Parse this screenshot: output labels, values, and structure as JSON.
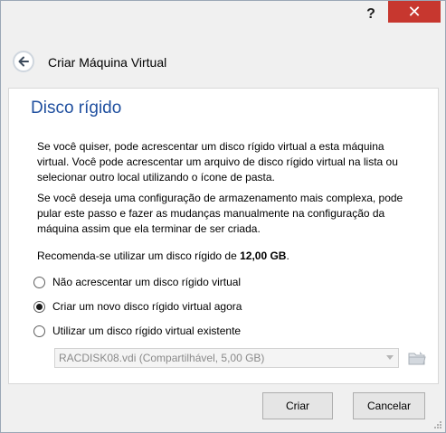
{
  "titlebar": {
    "help_label": "?",
    "close_label": "✕"
  },
  "wizard": {
    "title": "Criar Máquina Virtual"
  },
  "page": {
    "heading": "Disco rígido",
    "para1": "Se você quiser, pode acrescentar um disco rígido virtual a esta máquina virtual. Você pode acrescentar um arquivo de disco rígido virtual na lista ou selecionar outro local utilizando o ícone de pasta.",
    "para2": "Se você deseja uma configuração de armazenamento mais complexa, pode pular este passo e fazer as mudanças manualmente na configuração da máquina assim que ela terminar de ser criada.",
    "recommend_prefix": "Recomenda-se utilizar um disco rígido de ",
    "recommend_size": "12,00 GB",
    "recommend_suffix": "."
  },
  "options": [
    {
      "label": "Não acrescentar um disco rígido virtual",
      "selected": false
    },
    {
      "label": "Criar um novo disco rígido virtual agora",
      "selected": true
    },
    {
      "label": "Utilizar um disco rígido virtual existente",
      "selected": false
    }
  ],
  "disk_select": {
    "value": "RACDISK08.vdi (Compartilhável, 5,00 GB)"
  },
  "buttons": {
    "create": "Criar",
    "cancel": "Cancelar"
  },
  "colors": {
    "heading": "#1f4f9f",
    "close": "#c7372f"
  }
}
